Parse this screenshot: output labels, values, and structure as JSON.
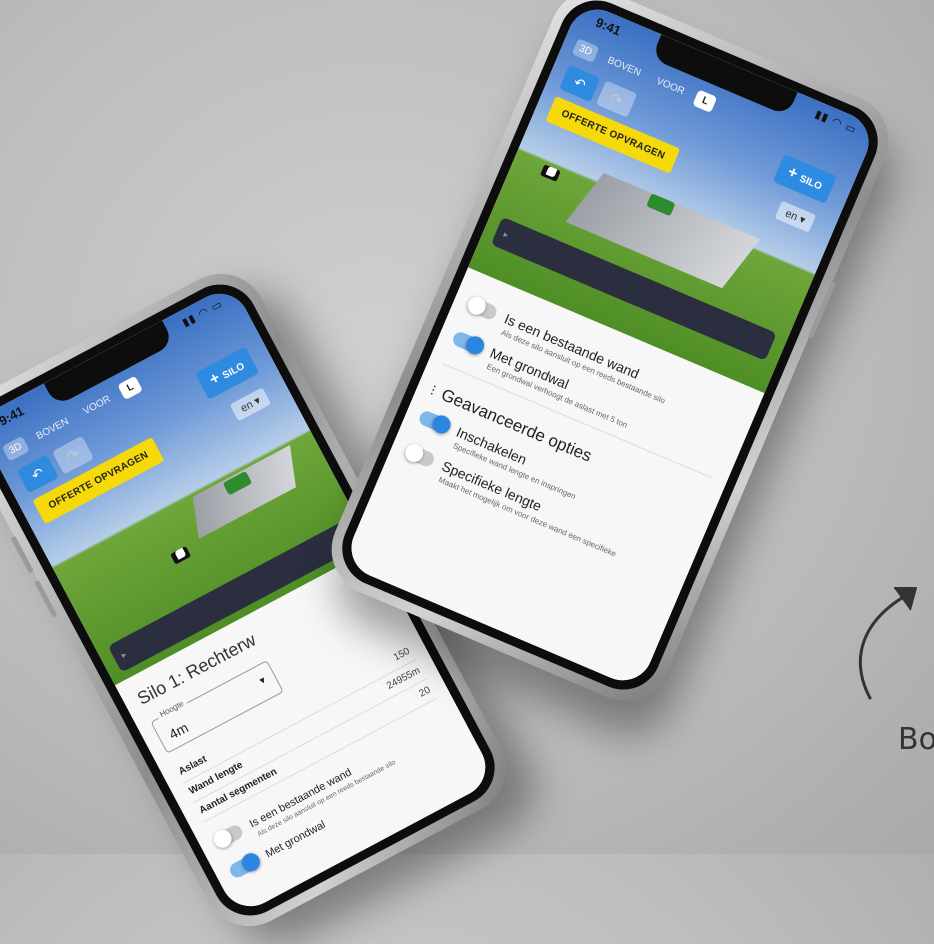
{
  "caption": "Bo",
  "phone_front": {
    "time": "9:41",
    "status_icons": "▮▮ ◠ ▭",
    "views": [
      "3D",
      "BOVEN",
      "VOOR"
    ],
    "view_L": "L",
    "undo_glyph": "↶",
    "redo_glyph": "↷",
    "add_silo_plus": "+",
    "add_silo_label": "SILO",
    "quote_label": "OFFERTE OPVRAGEN",
    "language": "en ▾",
    "existing_wall_label": "Is een bestaande wand",
    "existing_wall_hint": "Als deze silo aansluit op een reeds bestaande silo",
    "ground_wall_label": "Met grondwal",
    "ground_wall_hint": "Een grondwal verhoogt de aslast met 5 ton",
    "advanced_title": "Geavanceerde opties",
    "enable_label": "Inschakelen",
    "enable_hint": "Specifieke wand lengte en inspringen",
    "specific_length_label": "Specifieke lengte",
    "specific_length_hint": "Maakt het mogelijk om voor deze wand een specifieke"
  },
  "phone_back": {
    "time": "9:41",
    "status_icons": "▮▮ ◠ ▭",
    "views": [
      "3D",
      "BOVEN",
      "VOOR"
    ],
    "view_L": "L",
    "undo_glyph": "↶",
    "redo_glyph": "↷",
    "add_silo_plus": "+",
    "add_silo_label": "SILO",
    "quote_label": "OFFERTE OPVRAGEN",
    "language": "en ▾",
    "silo_title": "Silo 1: Rechterw",
    "height_label": "Hoogte",
    "height_value": "4m",
    "table": [
      {
        "k": "Aslast",
        "v": "150"
      },
      {
        "k": "Wand lengte",
        "v": "24955m"
      },
      {
        "k": "Aantal segmenten",
        "v": "20"
      }
    ],
    "existing_wall_label": "Is een bestaande wand",
    "existing_wall_hint": "Als deze silo aansluit op een reeds bestaande silo",
    "ground_wall_label": "Met grondwal"
  }
}
